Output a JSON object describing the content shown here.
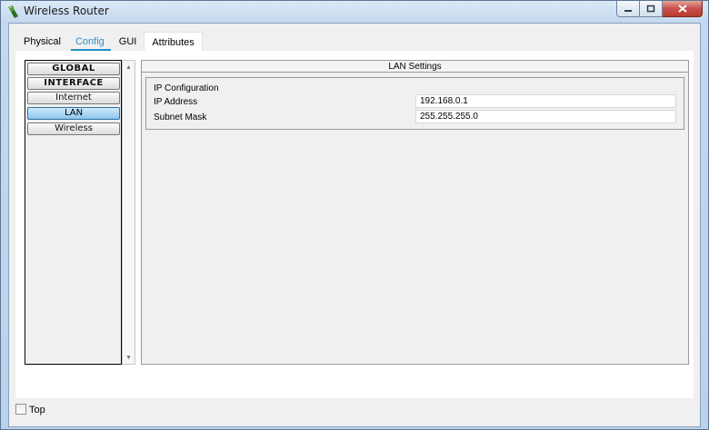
{
  "window": {
    "title": "Wireless Router",
    "controls": {
      "minimize": "minimize",
      "maximize": "maximize",
      "close": "close"
    }
  },
  "tabs": [
    {
      "label": "Physical",
      "active": false
    },
    {
      "label": "Config",
      "active": true
    },
    {
      "label": "GUI",
      "active": false
    },
    {
      "label": "Attributes",
      "active": false
    }
  ],
  "sidebar": {
    "items": [
      {
        "label": "GLOBAL",
        "type": "header"
      },
      {
        "label": "INTERFACE",
        "type": "header"
      },
      {
        "label": "Internet",
        "type": "item"
      },
      {
        "label": "LAN",
        "type": "item",
        "selected": true
      },
      {
        "label": "Wireless",
        "type": "item"
      }
    ]
  },
  "content": {
    "header": "LAN Settings",
    "group_title": "IP Configuration",
    "fields": [
      {
        "label": "IP Address",
        "value": "192.168.0.1"
      },
      {
        "label": "Subnet Mask",
        "value": "255.255.255.0"
      }
    ]
  },
  "bottom": {
    "checkbox_label": "Top",
    "checked": false
  },
  "colors": {
    "accent": "#1f8ec7",
    "selected_button": "#8cc6ee",
    "close_button": "#c75050"
  },
  "icons": [
    "router-app-icon",
    "minimize-icon",
    "maximize-icon",
    "close-icon",
    "scroll-up-arrow-icon",
    "scroll-down-arrow-icon"
  ]
}
